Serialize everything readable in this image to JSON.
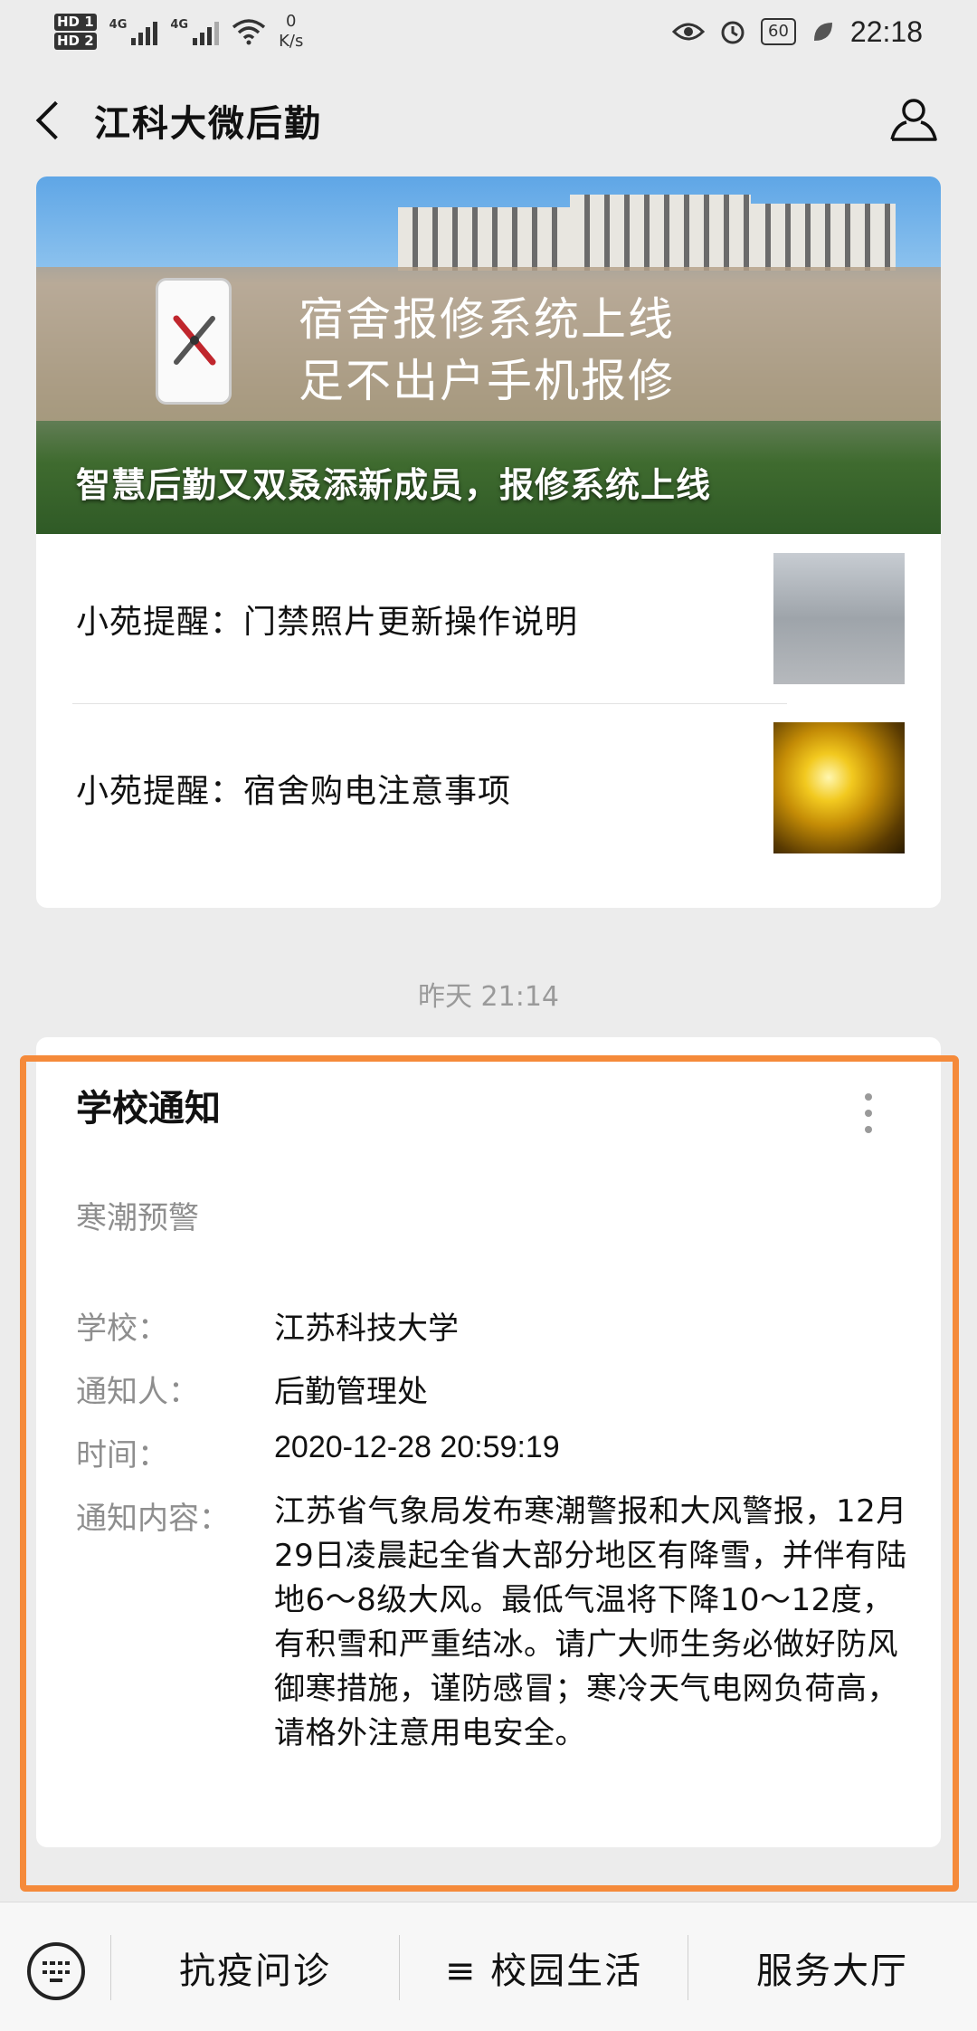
{
  "status_bar": {
    "hd1": "HD 1",
    "hd2": "HD 2",
    "net1": "4G",
    "net2": "4G",
    "speed_value": "0",
    "speed_unit": "K/s",
    "battery": "60",
    "time": "22:18"
  },
  "nav": {
    "title": "江科大微后勤",
    "back_icon": "back-arrow-icon",
    "profile_icon": "person-icon"
  },
  "article_card": {
    "banner_line1": "宿舍报修系统上线",
    "banner_line2": "足不出户手机报修",
    "banner_caption": "智慧后勤又双叒添新成员，报修系统上线",
    "items": [
      {
        "title": "小苑提醒：门禁照片更新操作说明"
      },
      {
        "title": "小苑提醒：宿舍购电注意事项"
      }
    ]
  },
  "timestamp": "昨天 21:14",
  "notice": {
    "title": "学校通知",
    "subtitle": "寒潮预警",
    "fields": [
      {
        "label": "学校：",
        "value": "江苏科技大学"
      },
      {
        "label": "通知人：",
        "value": "后勤管理处"
      },
      {
        "label": "时间：",
        "value": "2020-12-28 20:59:19"
      },
      {
        "label": "通知内容：",
        "value": "江苏省气象局发布寒潮警报和大风警报，12月29日凌晨起全省大部分地区有降雪，并伴有陆地6～8级大风。最低气温将下降10～12度，有积雪和严重结冰。请广大师生务必做好防风御寒措施，谨防感冒；寒冷天气电网负荷高，请格外注意用电安全。"
      }
    ],
    "highlight_color": "#f58a3a"
  },
  "bottom_menu": {
    "keyboard_icon": "keyboard-icon",
    "items": [
      {
        "label": "抗疫问诊"
      },
      {
        "label": "≡ 校园生活"
      },
      {
        "label": "服务大厅"
      }
    ]
  }
}
